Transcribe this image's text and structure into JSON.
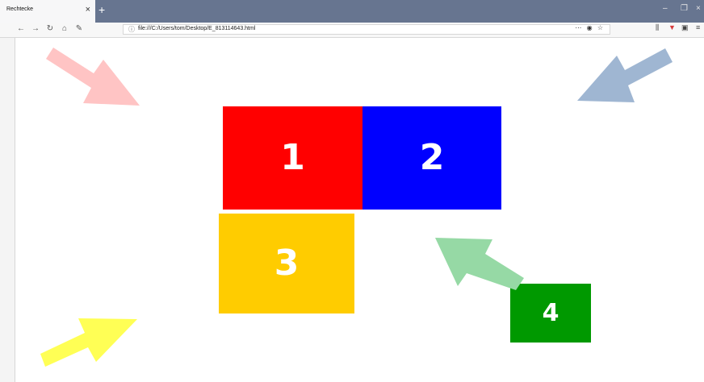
{
  "browser": {
    "tab_title": "Rechtecke",
    "tab_close": "×",
    "new_tab": "+",
    "window_controls": {
      "minimize": "–",
      "restore": "❐",
      "close": "×"
    },
    "url": "file:///C:/Users/tom/Desktop/E_813114643.html",
    "url_actions": "⋯ ◉ ☆"
  },
  "page": {
    "rectangles": [
      {
        "label": "1",
        "color": "#ff0000"
      },
      {
        "label": "2",
        "color": "#0000ff"
      },
      {
        "label": "3",
        "color": "#ffcc00"
      },
      {
        "label": "4",
        "color": "#009900"
      }
    ],
    "arrows": [
      {
        "color": "#ffc4c4",
        "points_to": "1"
      },
      {
        "color": "#9fb6d2",
        "points_to": "2"
      },
      {
        "color": "#ffff55",
        "points_to": "3"
      },
      {
        "color": "#96d9a5",
        "points_to": "4"
      }
    ]
  }
}
